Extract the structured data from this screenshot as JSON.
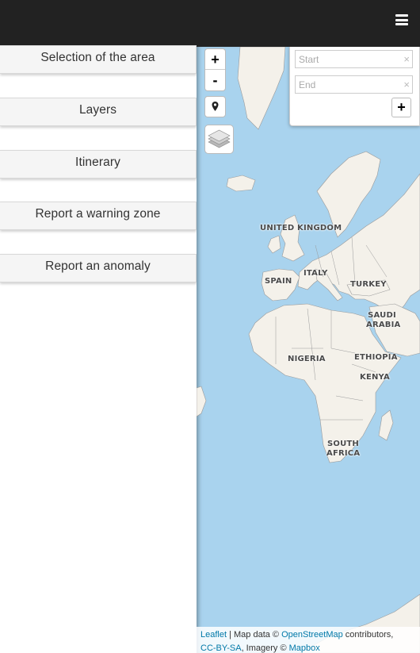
{
  "header": {
    "menu_icon": "hamburger-menu-icon"
  },
  "sidebar": {
    "items": [
      {
        "label": "Selection of the area"
      },
      {
        "label": "Layers"
      },
      {
        "label": "Itinerary"
      },
      {
        "label": "Report a warning zone"
      },
      {
        "label": "Report an anomaly"
      }
    ]
  },
  "map": {
    "zoom_in": "+",
    "zoom_out": "-",
    "locate_icon": "map-marker-icon",
    "layers_icon": "layers-icon",
    "route": {
      "start_placeholder": "Start",
      "end_placeholder": "End",
      "clear": "×",
      "add": "+"
    },
    "countries": [
      {
        "name": "UNITED KINGDOM"
      },
      {
        "name": "SPAIN"
      },
      {
        "name": "ITALY"
      },
      {
        "name": "TURKEY"
      },
      {
        "name": "SAUDI ARABIA"
      },
      {
        "name": "NIGERIA"
      },
      {
        "name": "ETHIOPIA"
      },
      {
        "name": "KENYA"
      },
      {
        "name": "SOUTH AFRICA"
      }
    ],
    "attribution": {
      "leaflet": "Leaflet",
      "sep": " | Map data © ",
      "osm": "OpenStreetMap",
      "contrib": " contributors,",
      "license": "CC-BY-SA",
      "imagery": ", Imagery © ",
      "mapbox": "Mapbox"
    },
    "colors": {
      "water": "#a9d3ee",
      "land": "#f4f1ea",
      "border": "#9a9a9a"
    }
  }
}
